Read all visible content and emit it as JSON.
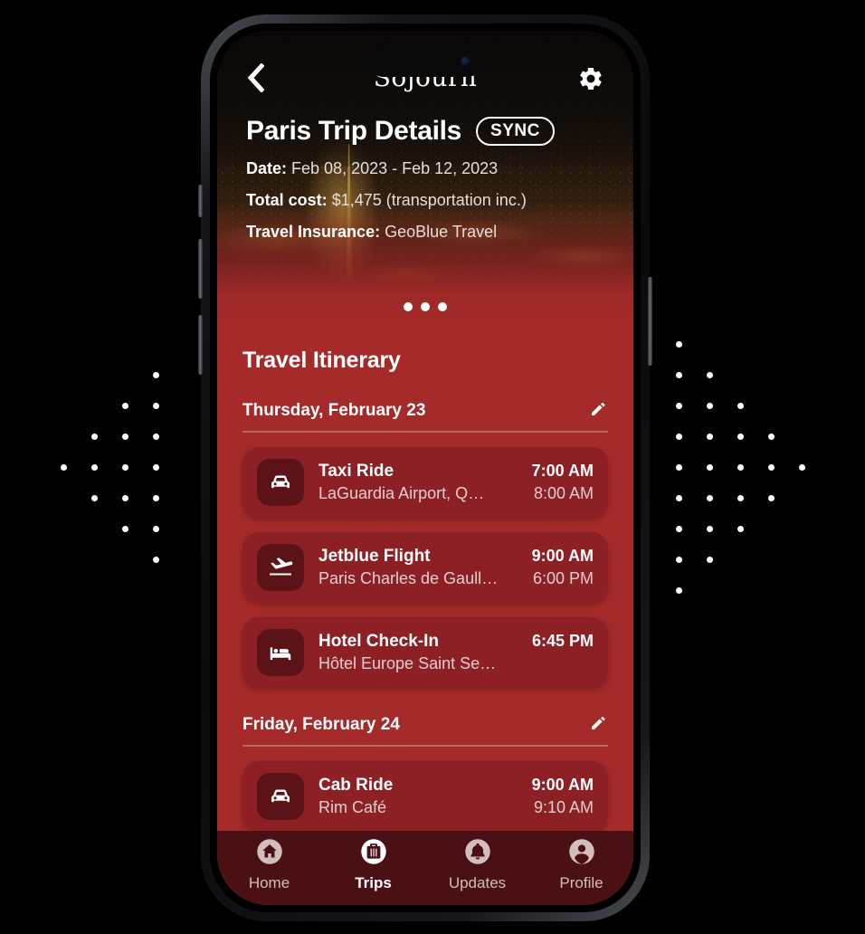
{
  "backdrop": {
    "dot_color": "#ffffff",
    "background": "#000000"
  },
  "theme": {
    "red_bg": "#A52A2A",
    "card_bg": "#8C2025",
    "icon_tile_bg": "#5B1317",
    "navbar_bg": "#4A1014",
    "text_primary": "#ffffff",
    "text_secondary": "#e3cfcf"
  },
  "topbar": {
    "back_icon": "chevron-left-icon",
    "app_title": "Sojourn",
    "settings_icon": "gear-icon"
  },
  "hero": {
    "page_title": "Paris Trip Details",
    "sync_label": "SYNC",
    "meta": [
      {
        "label": "Date:",
        "value": "Feb 08, 2023 - Feb 12, 2023"
      },
      {
        "label": "Total cost:",
        "value": "$1,475 (transportation inc.)"
      },
      {
        "label": "Travel Insurance:",
        "value": "GeoBlue Travel"
      }
    ],
    "more_icon": "ellipsis-icon"
  },
  "itinerary": {
    "heading": "Travel Itinerary",
    "days": [
      {
        "label": "Thursday, February 23",
        "edit_icon": "pencil-icon",
        "events": [
          {
            "icon": "car-icon",
            "title": "Taxi Ride",
            "subtitle": "LaGuardia Airport, Q…",
            "start": "7:00 AM",
            "end": "8:00 AM"
          },
          {
            "icon": "plane-icon",
            "title": "Jetblue Flight",
            "subtitle": "Paris Charles de Gaull…",
            "start": "9:00 AM",
            "end": "6:00 PM"
          },
          {
            "icon": "bed-icon",
            "title": "Hotel Check-In",
            "subtitle": "Hôtel Europe Saint Se…",
            "start": "6:45 PM",
            "end": ""
          }
        ]
      },
      {
        "label": "Friday, February 24",
        "edit_icon": "pencil-icon",
        "events": [
          {
            "icon": "car-icon",
            "title": "Cab Ride",
            "subtitle": "Rim Café",
            "start": "9:00 AM",
            "end": "9:10 AM"
          }
        ]
      }
    ]
  },
  "navbar": {
    "items": [
      {
        "icon": "home-icon",
        "label": "Home",
        "active": false
      },
      {
        "icon": "suitcase-icon",
        "label": "Trips",
        "active": true
      },
      {
        "icon": "bell-icon",
        "label": "Updates",
        "active": false
      },
      {
        "icon": "person-icon",
        "label": "Profile",
        "active": false
      }
    ]
  }
}
